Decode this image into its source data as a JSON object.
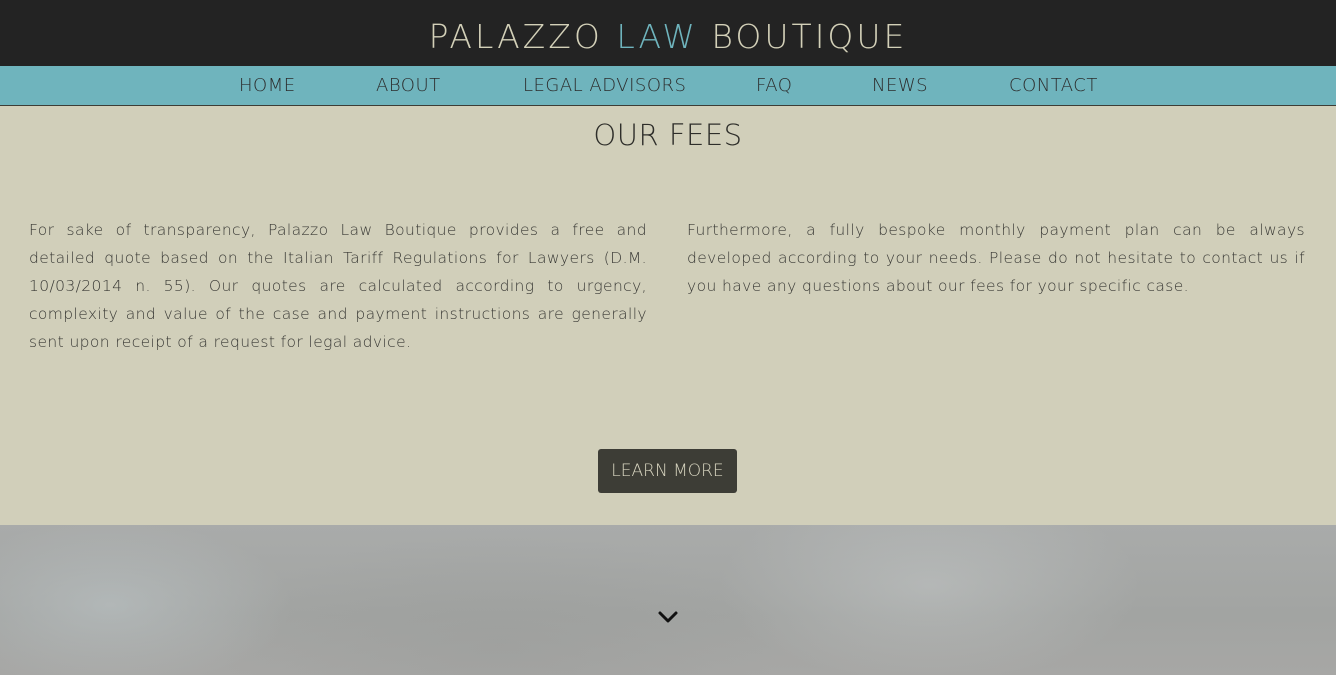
{
  "header": {
    "logo_part1": "PALAZZO ",
    "logo_accent": "LAW",
    "logo_part2": " BOUTIQUE"
  },
  "nav": {
    "items": [
      {
        "label": "HOME"
      },
      {
        "label": "ABOUT"
      },
      {
        "label": "LEGAL ADVISORS"
      },
      {
        "label": "FAQ"
      },
      {
        "label": "NEWS"
      },
      {
        "label": "CONTACT"
      }
    ]
  },
  "fees": {
    "title": "OUR FEES",
    "left_text": "For sake of transparency, Palazzo Law Boutique provides a free and detailed quote based on the Italian Tariff Regulations for Lawyers (D.M. 10/03/2014 n. 55). Our quotes are calculated according to urgency, complexity and value of the case and payment instructions are generally sent upon receipt of a request for legal advice.",
    "right_text": "Furthermore, a fully bespoke monthly payment plan can be always developed according to your needs. Please do not hesitate to contact us if you have any questions about our fees for your specific case.",
    "button_label": "LEARN MORE"
  },
  "hero": {
    "scroll_icon": "chevron-down-icon"
  },
  "colors": {
    "topbar": "#232323",
    "accent": "#6fb4bd",
    "background": "#d1cfba",
    "button": "#3d3d36"
  }
}
